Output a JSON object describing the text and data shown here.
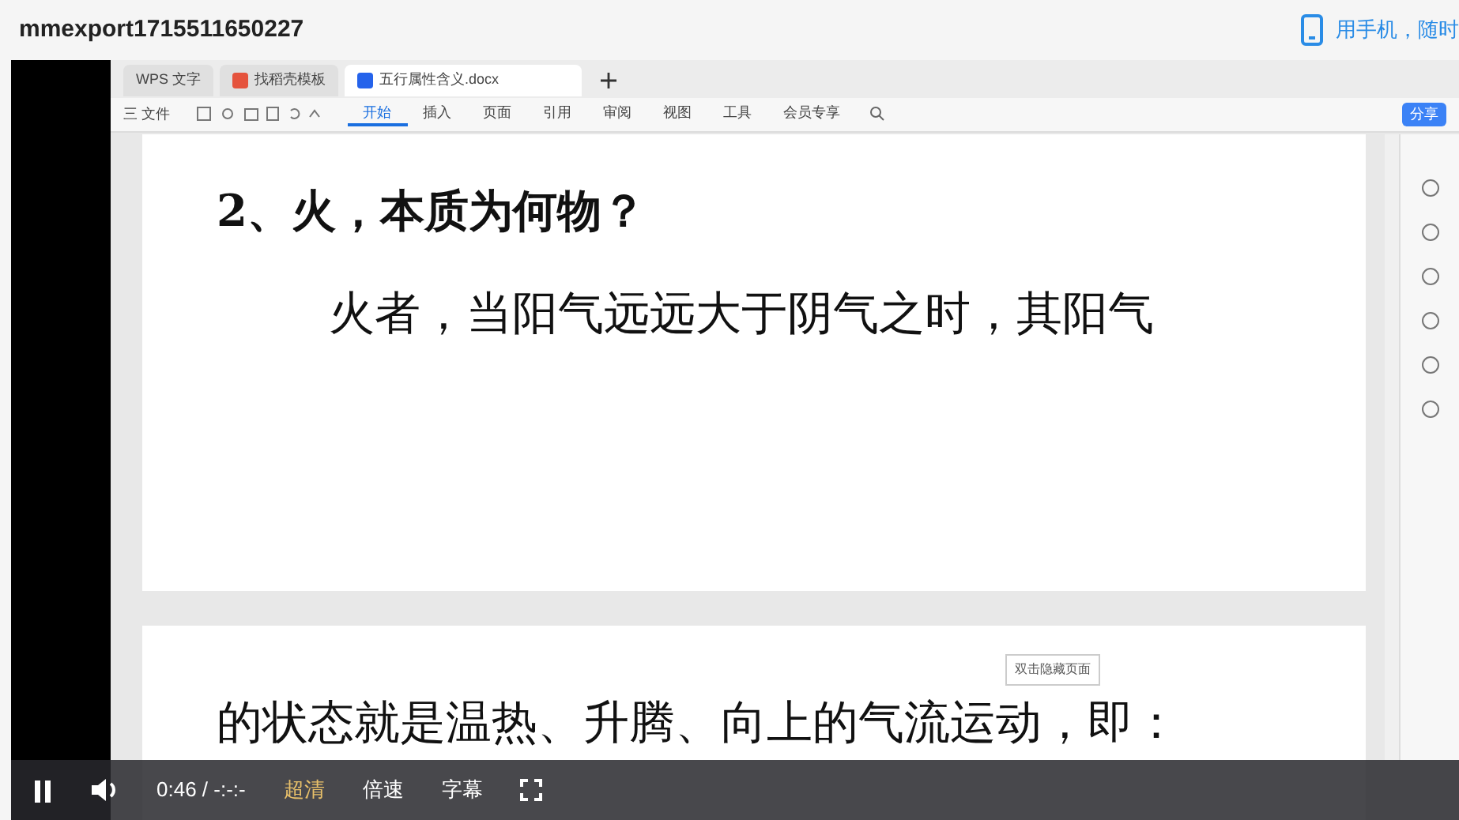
{
  "window": {
    "title": "mmexport1715511650227",
    "phone_link": "用手机，随时"
  },
  "wps": {
    "tabs": [
      {
        "label": "WPS 文字",
        "kind": "home",
        "selected": false
      },
      {
        "label": "找稻壳模板",
        "kind": "template",
        "selected": false
      },
      {
        "label": "五行属性含义.docx",
        "kind": "doc",
        "selected": true
      }
    ],
    "menu": [
      {
        "label": "开始",
        "selected": true
      },
      {
        "label": "插入",
        "selected": false
      },
      {
        "label": "页面",
        "selected": false
      },
      {
        "label": "引用",
        "selected": false
      },
      {
        "label": "审阅",
        "selected": false
      },
      {
        "label": "视图",
        "selected": false
      },
      {
        "label": "工具",
        "selected": false
      },
      {
        "label": "会员专享",
        "selected": false
      }
    ],
    "file_menu": "三 文件",
    "share": "分享"
  },
  "document": {
    "page1": [
      {
        "kind": "heading",
        "text": "2、火，本质为何物？"
      },
      {
        "kind": "para",
        "text": "火者，当阳气远远大于阴气之时，其阳气"
      }
    ],
    "tooltip": "双击隐藏页面",
    "page2": [
      {
        "kind": "para",
        "text": "的状态就是温热、升腾、向上的气流运动，即："
      }
    ]
  },
  "player": {
    "playing": true,
    "time": "0:46 / -:-:-",
    "quality": "超清",
    "speed": "倍速",
    "subtitles": "字幕"
  }
}
